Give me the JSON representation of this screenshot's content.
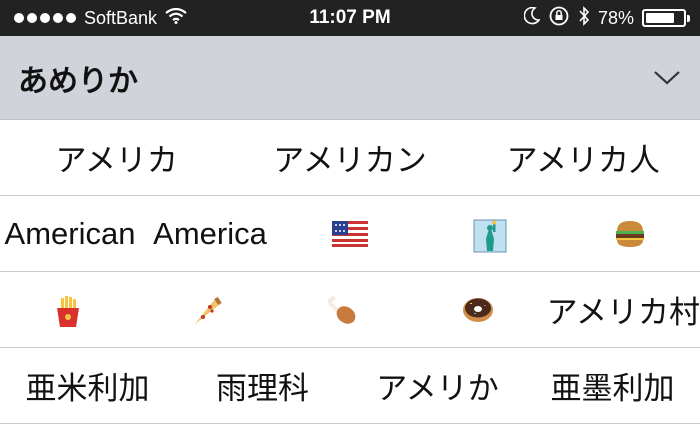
{
  "status_bar": {
    "carrier": "SoftBank",
    "time": "11:07 PM",
    "battery": "78%",
    "battery_level": 0.78,
    "icons": [
      "signal-dots-icon",
      "wifi-icon",
      "moon-icon",
      "rotation-lock-icon",
      "bluetooth-icon",
      "battery-icon"
    ]
  },
  "composition": {
    "text": "あめりか",
    "toggle_icon": "chevron-down-icon"
  },
  "candidates": {
    "row1": [
      "アメリカ",
      "アメリカン",
      "アメリカ人"
    ],
    "row2_text": [
      "American",
      "America"
    ],
    "row2_icons": [
      "us-flag-icon",
      "statue-of-liberty-icon",
      "hamburger-icon"
    ],
    "row3_icons": [
      "french-fries-icon",
      "pizza-icon",
      "poultry-leg-icon",
      "doughnut-icon"
    ],
    "row3_text": [
      "アメリカ村"
    ],
    "row4": [
      "亜米利加",
      "雨理科",
      "アメリか",
      "亜墨利加"
    ]
  }
}
